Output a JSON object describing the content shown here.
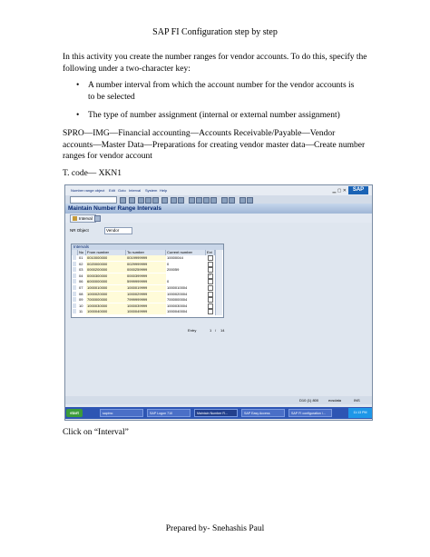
{
  "header": "SAP FI Configuration step by step",
  "intro": "In this activity you create the number ranges for vendor accounts. To do this, specify the following under a two-character key:",
  "bullets": [
    "A number interval from which the account number for the vendor accounts is to be selected",
    "The type of number assignment (internal or external number assignment)"
  ],
  "path": "SPRO—IMG—Financial accounting—Accounts Receivable/Payable—Vendor accounts––Master Data—Preparations for creating vendor master data—Create number ranges for vendor account",
  "tcode": "T. code— XKN1",
  "click_text": "Click on “Interval”",
  "footer": "Prepared by- Snehashis Paul",
  "screenshot": {
    "menu": [
      "Number range object",
      "Edit",
      "Goto",
      "Interval",
      "System",
      "Help"
    ],
    "logo": "SAP",
    "title": "Maintain Number Range Intervals",
    "interval_button": "Interval",
    "nr_object_label": "NR Object",
    "nr_object_value": "Vendor",
    "grid_title": "Intervals",
    "columns": [
      "No",
      "From number",
      "To number",
      "Current number",
      "Ext"
    ],
    "rows": [
      {
        "no": "01",
        "from": "0010000000",
        "to": "0019999999",
        "current": "10000044",
        "ext": false
      },
      {
        "no": "02",
        "from": "0020000000",
        "to": "0029999999",
        "current": "0",
        "ext": false
      },
      {
        "no": "03",
        "from": "0000200000",
        "to": "0000259999",
        "current": "200059",
        "ext": false
      },
      {
        "no": "04",
        "from": "0000300000",
        "to": "0000399999",
        "current": "",
        "ext": true
      },
      {
        "no": "06",
        "from": "6000000000",
        "to": "5999999999",
        "current": "0",
        "ext": false
      },
      {
        "no": "07",
        "from": "1000010000",
        "to": "1000019999",
        "current": "1000010004",
        "ext": false
      },
      {
        "no": "08",
        "from": "1000020000",
        "to": "1000029999",
        "current": "1000020004",
        "ext": false
      },
      {
        "no": "09",
        "from": "7000000000",
        "to": "7999999999",
        "current": "7000000004",
        "ext": false
      },
      {
        "no": "10",
        "from": "1000030000",
        "to": "1000039999",
        "current": "1000030004",
        "ext": false
      },
      {
        "no": "11",
        "from": "1000040000",
        "to": "1000049999",
        "current": "1000040004",
        "ext": false
      }
    ],
    "entry_label": "Entry",
    "entry_value": "1",
    "entry_sep": "/",
    "entry_total": "14",
    "status": "D10 (1) 800",
    "status_server": "ecsdata",
    "status_mode": "INS",
    "taskbar": {
      "start": "start",
      "items": [
        "sapimc",
        "SAP Logon 710",
        "Maintain Number R...",
        "SAP Easy Access",
        "SAP FI configuration i..."
      ],
      "clock": "11:13 PM"
    }
  }
}
